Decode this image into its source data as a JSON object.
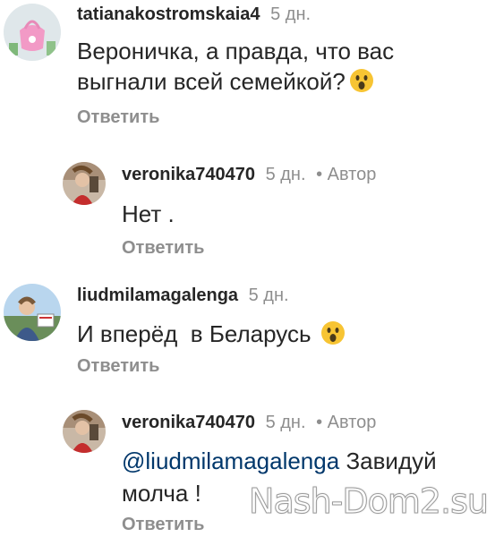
{
  "comments": [
    {
      "username": "tatianakostromskaia4",
      "time": "5 дн.",
      "author_badge": "",
      "text": "Вероничка, а правда, что вас выгнали всей семейкой?",
      "emoji": "astonished-face",
      "reply": "Ответить"
    },
    {
      "username": "veronika740470",
      "time": "5 дн.",
      "author_badge": "• Автор",
      "text": "Нет .",
      "reply": "Ответить"
    },
    {
      "username": "liudmilamagalenga",
      "time": "5 дн.",
      "author_badge": "",
      "text": "И вперёд  в Беларусь",
      "emoji": "astonished-face",
      "reply": "Ответить"
    },
    {
      "username": "veronika740470",
      "time": "5 дн.",
      "author_badge": "• Автор",
      "mention": "@liudmilamagalenga",
      "text": "Завидуй",
      "text_line2": "молча !",
      "reply": "Ответить"
    }
  ],
  "watermark": "Nash-Dom2.su",
  "colors": {
    "username": "#262626",
    "meta": "#8e8e8e",
    "mention": "#00376b",
    "emoji": "#f7c433"
  }
}
